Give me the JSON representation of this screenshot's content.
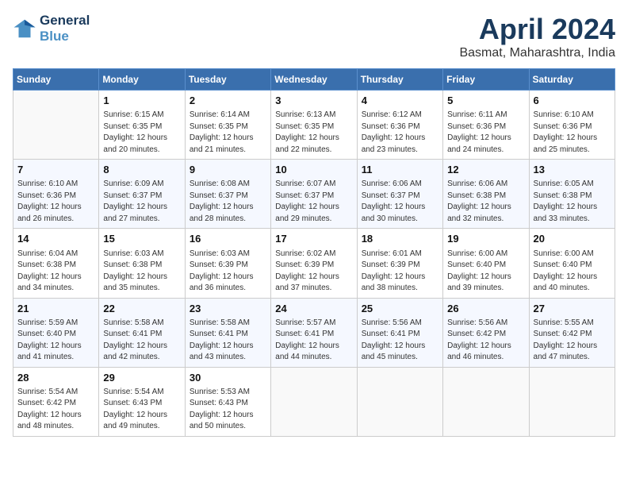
{
  "logo": {
    "line1": "General",
    "line2": "Blue"
  },
  "title": "April 2024",
  "location": "Basmat, Maharashtra, India",
  "headers": [
    "Sunday",
    "Monday",
    "Tuesday",
    "Wednesday",
    "Thursday",
    "Friday",
    "Saturday"
  ],
  "weeks": [
    [
      {
        "day": "",
        "info": ""
      },
      {
        "day": "1",
        "info": "Sunrise: 6:15 AM\nSunset: 6:35 PM\nDaylight: 12 hours\nand 20 minutes."
      },
      {
        "day": "2",
        "info": "Sunrise: 6:14 AM\nSunset: 6:35 PM\nDaylight: 12 hours\nand 21 minutes."
      },
      {
        "day": "3",
        "info": "Sunrise: 6:13 AM\nSunset: 6:35 PM\nDaylight: 12 hours\nand 22 minutes."
      },
      {
        "day": "4",
        "info": "Sunrise: 6:12 AM\nSunset: 6:36 PM\nDaylight: 12 hours\nand 23 minutes."
      },
      {
        "day": "5",
        "info": "Sunrise: 6:11 AM\nSunset: 6:36 PM\nDaylight: 12 hours\nand 24 minutes."
      },
      {
        "day": "6",
        "info": "Sunrise: 6:10 AM\nSunset: 6:36 PM\nDaylight: 12 hours\nand 25 minutes."
      }
    ],
    [
      {
        "day": "7",
        "info": "Sunrise: 6:10 AM\nSunset: 6:36 PM\nDaylight: 12 hours\nand 26 minutes."
      },
      {
        "day": "8",
        "info": "Sunrise: 6:09 AM\nSunset: 6:37 PM\nDaylight: 12 hours\nand 27 minutes."
      },
      {
        "day": "9",
        "info": "Sunrise: 6:08 AM\nSunset: 6:37 PM\nDaylight: 12 hours\nand 28 minutes."
      },
      {
        "day": "10",
        "info": "Sunrise: 6:07 AM\nSunset: 6:37 PM\nDaylight: 12 hours\nand 29 minutes."
      },
      {
        "day": "11",
        "info": "Sunrise: 6:06 AM\nSunset: 6:37 PM\nDaylight: 12 hours\nand 30 minutes."
      },
      {
        "day": "12",
        "info": "Sunrise: 6:06 AM\nSunset: 6:38 PM\nDaylight: 12 hours\nand 32 minutes."
      },
      {
        "day": "13",
        "info": "Sunrise: 6:05 AM\nSunset: 6:38 PM\nDaylight: 12 hours\nand 33 minutes."
      }
    ],
    [
      {
        "day": "14",
        "info": "Sunrise: 6:04 AM\nSunset: 6:38 PM\nDaylight: 12 hours\nand 34 minutes."
      },
      {
        "day": "15",
        "info": "Sunrise: 6:03 AM\nSunset: 6:38 PM\nDaylight: 12 hours\nand 35 minutes."
      },
      {
        "day": "16",
        "info": "Sunrise: 6:03 AM\nSunset: 6:39 PM\nDaylight: 12 hours\nand 36 minutes."
      },
      {
        "day": "17",
        "info": "Sunrise: 6:02 AM\nSunset: 6:39 PM\nDaylight: 12 hours\nand 37 minutes."
      },
      {
        "day": "18",
        "info": "Sunrise: 6:01 AM\nSunset: 6:39 PM\nDaylight: 12 hours\nand 38 minutes."
      },
      {
        "day": "19",
        "info": "Sunrise: 6:00 AM\nSunset: 6:40 PM\nDaylight: 12 hours\nand 39 minutes."
      },
      {
        "day": "20",
        "info": "Sunrise: 6:00 AM\nSunset: 6:40 PM\nDaylight: 12 hours\nand 40 minutes."
      }
    ],
    [
      {
        "day": "21",
        "info": "Sunrise: 5:59 AM\nSunset: 6:40 PM\nDaylight: 12 hours\nand 41 minutes."
      },
      {
        "day": "22",
        "info": "Sunrise: 5:58 AM\nSunset: 6:41 PM\nDaylight: 12 hours\nand 42 minutes."
      },
      {
        "day": "23",
        "info": "Sunrise: 5:58 AM\nSunset: 6:41 PM\nDaylight: 12 hours\nand 43 minutes."
      },
      {
        "day": "24",
        "info": "Sunrise: 5:57 AM\nSunset: 6:41 PM\nDaylight: 12 hours\nand 44 minutes."
      },
      {
        "day": "25",
        "info": "Sunrise: 5:56 AM\nSunset: 6:41 PM\nDaylight: 12 hours\nand 45 minutes."
      },
      {
        "day": "26",
        "info": "Sunrise: 5:56 AM\nSunset: 6:42 PM\nDaylight: 12 hours\nand 46 minutes."
      },
      {
        "day": "27",
        "info": "Sunrise: 5:55 AM\nSunset: 6:42 PM\nDaylight: 12 hours\nand 47 minutes."
      }
    ],
    [
      {
        "day": "28",
        "info": "Sunrise: 5:54 AM\nSunset: 6:42 PM\nDaylight: 12 hours\nand 48 minutes."
      },
      {
        "day": "29",
        "info": "Sunrise: 5:54 AM\nSunset: 6:43 PM\nDaylight: 12 hours\nand 49 minutes."
      },
      {
        "day": "30",
        "info": "Sunrise: 5:53 AM\nSunset: 6:43 PM\nDaylight: 12 hours\nand 50 minutes."
      },
      {
        "day": "",
        "info": ""
      },
      {
        "day": "",
        "info": ""
      },
      {
        "day": "",
        "info": ""
      },
      {
        "day": "",
        "info": ""
      }
    ]
  ]
}
